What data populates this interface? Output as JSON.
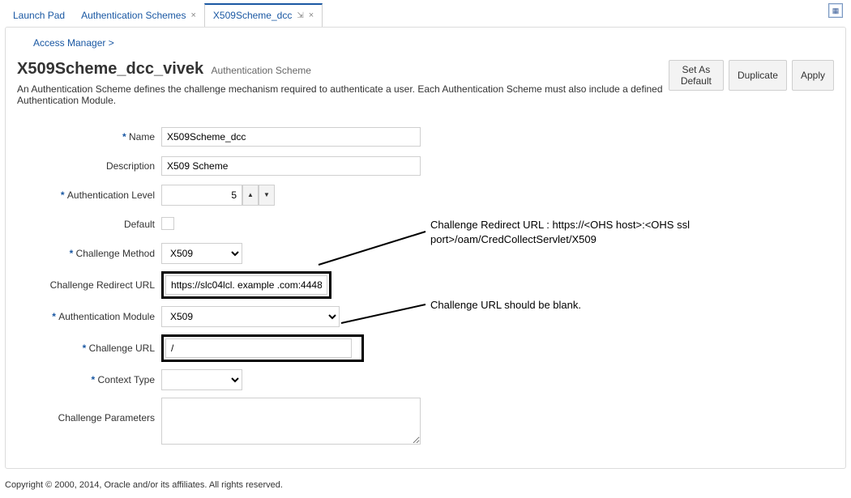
{
  "tabs": {
    "launch_pad": "Launch Pad",
    "auth_schemes": "Authentication Schemes",
    "current": "X509Scheme_dcc"
  },
  "breadcrumb": "Access Manager >",
  "header": {
    "title": "X509Scheme_dcc_vivek",
    "subtitle": "Authentication Scheme",
    "description": "An Authentication Scheme defines the challenge mechanism required to authenticate a user. Each Authentication Scheme must also include a defined Authentication Module."
  },
  "buttons": {
    "set_default": "Set As Default",
    "duplicate": "Duplicate",
    "apply": "Apply"
  },
  "form": {
    "labels": {
      "name": "Name",
      "description": "Description",
      "auth_level": "Authentication Level",
      "default": "Default",
      "challenge_method": "Challenge Method",
      "challenge_redirect_url": "Challenge Redirect URL",
      "auth_module": "Authentication Module",
      "challenge_url": "Challenge URL",
      "context_type": "Context Type",
      "challenge_params": "Challenge Parameters"
    },
    "values": {
      "name": "X509Scheme_dcc",
      "description": "X509 Scheme",
      "auth_level": "5",
      "challenge_method": "X509",
      "challenge_redirect_url": "https://slc04lcl. example .com:4448",
      "auth_module": "X509",
      "challenge_url": "/",
      "context_type": "",
      "challenge_params": ""
    }
  },
  "annotations": {
    "redirect": "Challenge Redirect URL : https://<OHS host>:<OHS ssl port>/oam/CredCollectServlet/X509",
    "blank": "Challenge URL should be blank."
  },
  "footer": "Copyright © 2000, 2014, Oracle and/or its affiliates. All rights reserved."
}
